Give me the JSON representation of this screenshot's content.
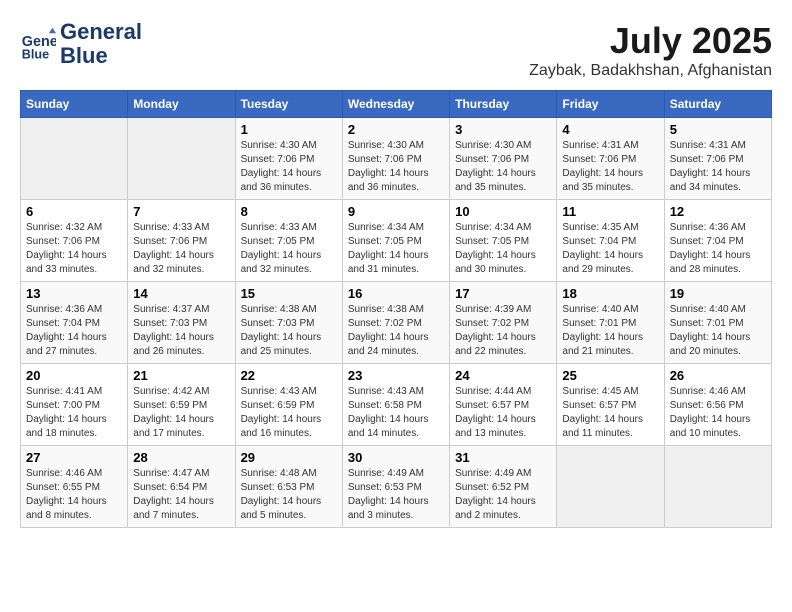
{
  "header": {
    "logo_line1": "General",
    "logo_line2": "Blue",
    "month": "July 2025",
    "location": "Zaybak, Badakhshan, Afghanistan"
  },
  "weekdays": [
    "Sunday",
    "Monday",
    "Tuesday",
    "Wednesday",
    "Thursday",
    "Friday",
    "Saturday"
  ],
  "weeks": [
    [
      {
        "day": "",
        "sunrise": "",
        "sunset": "",
        "daylight": ""
      },
      {
        "day": "",
        "sunrise": "",
        "sunset": "",
        "daylight": ""
      },
      {
        "day": "1",
        "sunrise": "Sunrise: 4:30 AM",
        "sunset": "Sunset: 7:06 PM",
        "daylight": "Daylight: 14 hours and 36 minutes."
      },
      {
        "day": "2",
        "sunrise": "Sunrise: 4:30 AM",
        "sunset": "Sunset: 7:06 PM",
        "daylight": "Daylight: 14 hours and 36 minutes."
      },
      {
        "day": "3",
        "sunrise": "Sunrise: 4:30 AM",
        "sunset": "Sunset: 7:06 PM",
        "daylight": "Daylight: 14 hours and 35 minutes."
      },
      {
        "day": "4",
        "sunrise": "Sunrise: 4:31 AM",
        "sunset": "Sunset: 7:06 PM",
        "daylight": "Daylight: 14 hours and 35 minutes."
      },
      {
        "day": "5",
        "sunrise": "Sunrise: 4:31 AM",
        "sunset": "Sunset: 7:06 PM",
        "daylight": "Daylight: 14 hours and 34 minutes."
      }
    ],
    [
      {
        "day": "6",
        "sunrise": "Sunrise: 4:32 AM",
        "sunset": "Sunset: 7:06 PM",
        "daylight": "Daylight: 14 hours and 33 minutes."
      },
      {
        "day": "7",
        "sunrise": "Sunrise: 4:33 AM",
        "sunset": "Sunset: 7:06 PM",
        "daylight": "Daylight: 14 hours and 32 minutes."
      },
      {
        "day": "8",
        "sunrise": "Sunrise: 4:33 AM",
        "sunset": "Sunset: 7:05 PM",
        "daylight": "Daylight: 14 hours and 32 minutes."
      },
      {
        "day": "9",
        "sunrise": "Sunrise: 4:34 AM",
        "sunset": "Sunset: 7:05 PM",
        "daylight": "Daylight: 14 hours and 31 minutes."
      },
      {
        "day": "10",
        "sunrise": "Sunrise: 4:34 AM",
        "sunset": "Sunset: 7:05 PM",
        "daylight": "Daylight: 14 hours and 30 minutes."
      },
      {
        "day": "11",
        "sunrise": "Sunrise: 4:35 AM",
        "sunset": "Sunset: 7:04 PM",
        "daylight": "Daylight: 14 hours and 29 minutes."
      },
      {
        "day": "12",
        "sunrise": "Sunrise: 4:36 AM",
        "sunset": "Sunset: 7:04 PM",
        "daylight": "Daylight: 14 hours and 28 minutes."
      }
    ],
    [
      {
        "day": "13",
        "sunrise": "Sunrise: 4:36 AM",
        "sunset": "Sunset: 7:04 PM",
        "daylight": "Daylight: 14 hours and 27 minutes."
      },
      {
        "day": "14",
        "sunrise": "Sunrise: 4:37 AM",
        "sunset": "Sunset: 7:03 PM",
        "daylight": "Daylight: 14 hours and 26 minutes."
      },
      {
        "day": "15",
        "sunrise": "Sunrise: 4:38 AM",
        "sunset": "Sunset: 7:03 PM",
        "daylight": "Daylight: 14 hours and 25 minutes."
      },
      {
        "day": "16",
        "sunrise": "Sunrise: 4:38 AM",
        "sunset": "Sunset: 7:02 PM",
        "daylight": "Daylight: 14 hours and 24 minutes."
      },
      {
        "day": "17",
        "sunrise": "Sunrise: 4:39 AM",
        "sunset": "Sunset: 7:02 PM",
        "daylight": "Daylight: 14 hours and 22 minutes."
      },
      {
        "day": "18",
        "sunrise": "Sunrise: 4:40 AM",
        "sunset": "Sunset: 7:01 PM",
        "daylight": "Daylight: 14 hours and 21 minutes."
      },
      {
        "day": "19",
        "sunrise": "Sunrise: 4:40 AM",
        "sunset": "Sunset: 7:01 PM",
        "daylight": "Daylight: 14 hours and 20 minutes."
      }
    ],
    [
      {
        "day": "20",
        "sunrise": "Sunrise: 4:41 AM",
        "sunset": "Sunset: 7:00 PM",
        "daylight": "Daylight: 14 hours and 18 minutes."
      },
      {
        "day": "21",
        "sunrise": "Sunrise: 4:42 AM",
        "sunset": "Sunset: 6:59 PM",
        "daylight": "Daylight: 14 hours and 17 minutes."
      },
      {
        "day": "22",
        "sunrise": "Sunrise: 4:43 AM",
        "sunset": "Sunset: 6:59 PM",
        "daylight": "Daylight: 14 hours and 16 minutes."
      },
      {
        "day": "23",
        "sunrise": "Sunrise: 4:43 AM",
        "sunset": "Sunset: 6:58 PM",
        "daylight": "Daylight: 14 hours and 14 minutes."
      },
      {
        "day": "24",
        "sunrise": "Sunrise: 4:44 AM",
        "sunset": "Sunset: 6:57 PM",
        "daylight": "Daylight: 14 hours and 13 minutes."
      },
      {
        "day": "25",
        "sunrise": "Sunrise: 4:45 AM",
        "sunset": "Sunset: 6:57 PM",
        "daylight": "Daylight: 14 hours and 11 minutes."
      },
      {
        "day": "26",
        "sunrise": "Sunrise: 4:46 AM",
        "sunset": "Sunset: 6:56 PM",
        "daylight": "Daylight: 14 hours and 10 minutes."
      }
    ],
    [
      {
        "day": "27",
        "sunrise": "Sunrise: 4:46 AM",
        "sunset": "Sunset: 6:55 PM",
        "daylight": "Daylight: 14 hours and 8 minutes."
      },
      {
        "day": "28",
        "sunrise": "Sunrise: 4:47 AM",
        "sunset": "Sunset: 6:54 PM",
        "daylight": "Daylight: 14 hours and 7 minutes."
      },
      {
        "day": "29",
        "sunrise": "Sunrise: 4:48 AM",
        "sunset": "Sunset: 6:53 PM",
        "daylight": "Daylight: 14 hours and 5 minutes."
      },
      {
        "day": "30",
        "sunrise": "Sunrise: 4:49 AM",
        "sunset": "Sunset: 6:53 PM",
        "daylight": "Daylight: 14 hours and 3 minutes."
      },
      {
        "day": "31",
        "sunrise": "Sunrise: 4:49 AM",
        "sunset": "Sunset: 6:52 PM",
        "daylight": "Daylight: 14 hours and 2 minutes."
      },
      {
        "day": "",
        "sunrise": "",
        "sunset": "",
        "daylight": ""
      },
      {
        "day": "",
        "sunrise": "",
        "sunset": "",
        "daylight": ""
      }
    ]
  ]
}
